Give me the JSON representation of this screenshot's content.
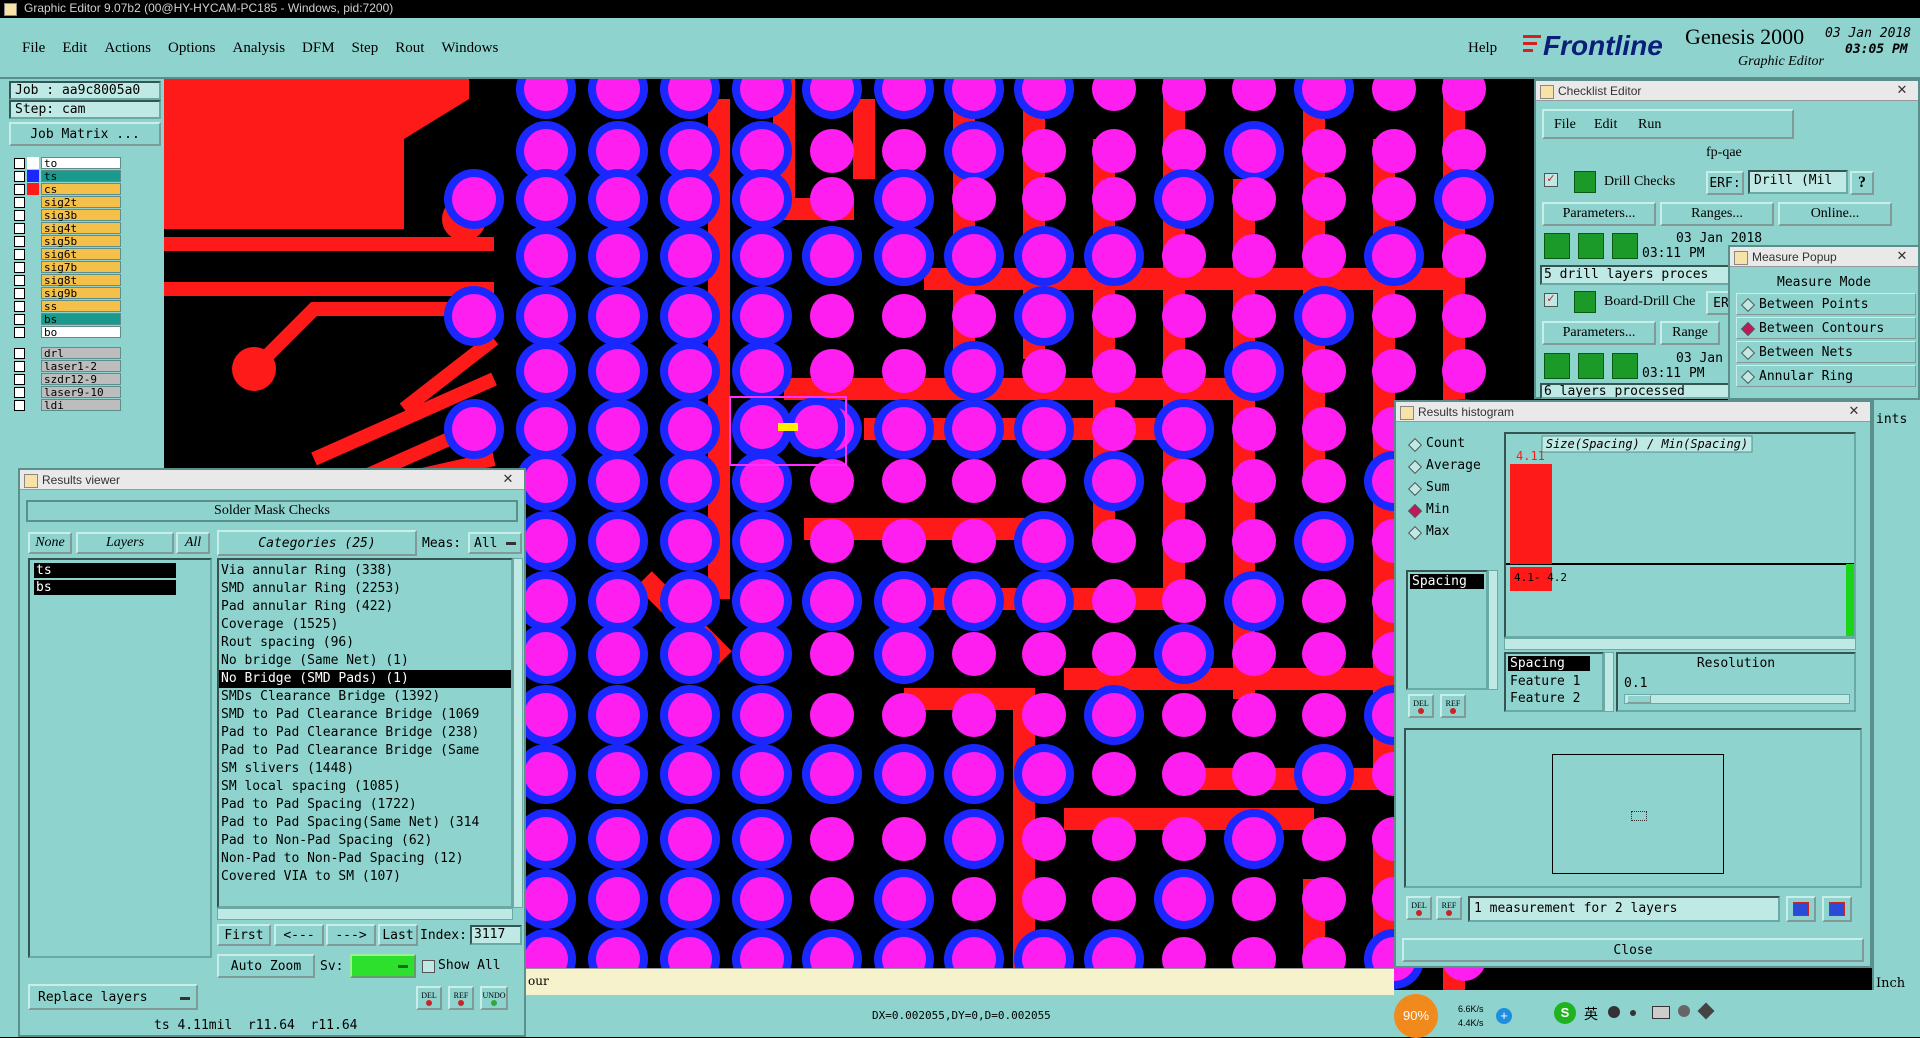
{
  "window_title": "Graphic Editor 9.07b2 (00@HY-HYCAM-PC185 - Windows, pid:7200)",
  "menu": [
    "File",
    "Edit",
    "Actions",
    "Options",
    "Analysis",
    "DFM",
    "Step",
    "Rout",
    "Windows"
  ],
  "help": "Help",
  "brand": {
    "logo": "Frontline",
    "product": "Genesis 2000",
    "subtitle": "Graphic Editor",
    "date": "03 Jan 2018",
    "time": "03:05 PM"
  },
  "job": {
    "job_label": "Job : aa9c8005a0",
    "step_label": "Step: cam",
    "matrix_btn": "Job Matrix ..."
  },
  "layers": [
    {
      "name": "to",
      "color": "#ffffff",
      "swatch": "#ffffff"
    },
    {
      "name": "ts",
      "color": "#1a9a8c",
      "swatch": "#1b27ff"
    },
    {
      "name": "cs",
      "color": "#f5c04a",
      "swatch": "#ff1a1a"
    },
    {
      "name": "sig2t",
      "color": "#f5c04a",
      "swatch": ""
    },
    {
      "name": "sig3b",
      "color": "#f5c04a",
      "swatch": ""
    },
    {
      "name": "sig4t",
      "color": "#f5c04a",
      "swatch": ""
    },
    {
      "name": "sig5b",
      "color": "#f5c04a",
      "swatch": ""
    },
    {
      "name": "sig6t",
      "color": "#f5c04a",
      "swatch": ""
    },
    {
      "name": "sig7b",
      "color": "#f5c04a",
      "swatch": ""
    },
    {
      "name": "sig8t",
      "color": "#f5c04a",
      "swatch": ""
    },
    {
      "name": "sig9b",
      "color": "#f5c04a",
      "swatch": ""
    },
    {
      "name": "ss",
      "color": "#f5c04a",
      "swatch": ""
    },
    {
      "name": "bs",
      "color": "#1a9a8c",
      "swatch": ""
    },
    {
      "name": "bo",
      "color": "#ffffff",
      "swatch": ""
    }
  ],
  "drill_layers": [
    "drl",
    "laser1-2",
    "szdr12-9",
    "laser9-10",
    "ldi"
  ],
  "results_viewer": {
    "title": "Results viewer",
    "header": "Solder Mask Checks",
    "none": "None",
    "layers": "Layers",
    "all": "All",
    "selected_layers": [
      "ts",
      "bs"
    ],
    "categories_label": "Categories (25)",
    "meas_label": "Meas:",
    "meas_value": "All",
    "categories": [
      "Via annular Ring (338)",
      "SMD annular Ring (2253)",
      "Pad annular Ring (422)",
      "Coverage (1525)",
      "Rout spacing (96)",
      "No bridge (Same Net) (1)",
      "No Bridge (SMD Pads) (1)",
      "SMDs Clearance Bridge (1392)",
      "SMD to Pad Clearance Bridge (1069",
      "Pad to Pad Clearance Bridge (238)",
      "Pad to Pad Clearance Bridge (Same",
      "SM slivers (1448)",
      "SM local spacing (1085)",
      "Pad to Pad Spacing (1722)",
      "Pad to Pad Spacing(Same Net) (314",
      "Pad to Non-Pad Spacing (62)",
      "Non-Pad to Non-Pad Spacing (12)",
      "Covered VIA to SM (107)"
    ],
    "selected_category_index": 6,
    "first": "First",
    "prev": "<---",
    "next": "--->",
    "last": "Last",
    "index_label": "Index:",
    "index_value": "3117",
    "auto_zoom": "Auto Zoom",
    "sv_label": "Sv:",
    "show_all": "Show All",
    "replace_layers": "Replace layers",
    "del": "DEL",
    "ref": "REF",
    "undo": "UNDO",
    "status": "ts 4.11mil  r11.64  r11.64"
  },
  "checklist_editor": {
    "title": "Checklist Editor",
    "menu": [
      "File",
      "Edit",
      "Run"
    ],
    "name": "fp-qae",
    "check1": {
      "name": "Drill Checks",
      "erf_label": "ERF:",
      "erf_value": "Drill (Mil",
      "params": "Parameters...",
      "ranges": "Ranges...",
      "online": "Online...",
      "date": "03 Jan 2018",
      "time": "03:11 PM",
      "msg": "5 drill layers proces"
    },
    "check2": {
      "name": "Board-Drill Che",
      "erf_label": "ER",
      "params": "Parameters...",
      "ranges": "Range",
      "date": "03 Jan",
      "time": "03:11 PM",
      "msg": "6 layers processed"
    }
  },
  "measure_popup": {
    "title": "Measure Popup",
    "mode_label": "Measure Mode",
    "modes": [
      "Between Points",
      "Between Contours",
      "Between Nets",
      "Annular Ring"
    ],
    "selected": 1,
    "cut_text": "ints"
  },
  "histogram": {
    "title": "Results histogram",
    "options": [
      "Count",
      "Average",
      "Sum",
      "Min",
      "Max"
    ],
    "selected_option": 3,
    "list_item": "Spacing",
    "chart_title": "Size(Spacing) / Min(Spacing)",
    "bar_value_label": "4.11",
    "bar_range_label": "4.1- 4.2",
    "fields": [
      "Spacing",
      "Feature 1",
      "Feature 2"
    ],
    "resolution_label": "Resolution",
    "resolution_value": "0.1",
    "summary": "1 measurement for 2 layers",
    "close": "Close",
    "del": "DEL",
    "ref": "REF"
  },
  "bottom": {
    "coords": "DX=0.002055,DY=0,D=0.002055",
    "frag": "our",
    "inch": "Inch"
  },
  "tray": {
    "percent": "90%",
    "up": "6.6K/s",
    "down": "4.4K/s",
    "ime": "英"
  }
}
